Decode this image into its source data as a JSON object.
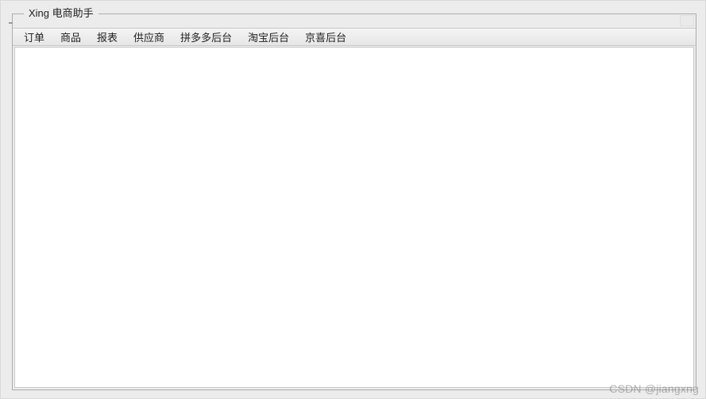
{
  "window": {
    "title": "Xing 电商助手"
  },
  "menubar": {
    "items": [
      {
        "label": "订单"
      },
      {
        "label": "商品"
      },
      {
        "label": "报表"
      },
      {
        "label": "供应商"
      },
      {
        "label": "拼多多后台"
      },
      {
        "label": "淘宝后台"
      },
      {
        "label": "京喜后台"
      }
    ]
  },
  "watermark": "CSDN @jiangxng"
}
